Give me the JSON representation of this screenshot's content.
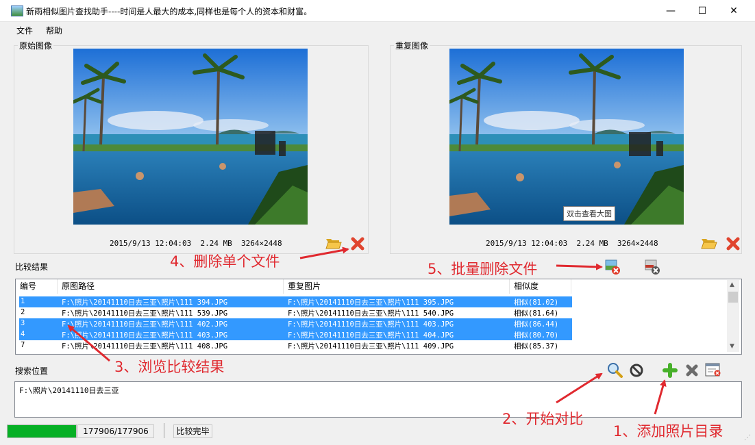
{
  "window": {
    "title": "新雨相似图片查找助手----时间是人最大的成本,同样也是每个人的资本和财富。",
    "minimize_glyph": "—",
    "maximize_glyph": "☐",
    "close_glyph": "✕"
  },
  "menu": {
    "file": "文件",
    "help": "帮助"
  },
  "original_panel": {
    "label": "原始图像",
    "info": "2015/9/13 12:04:03  2.24 MB  3264×2448"
  },
  "duplicate_panel": {
    "label": "重复图像",
    "info": "2015/9/13 12:04:03  2.24 MB  3264×2448",
    "tooltip": "双击查看大图"
  },
  "results": {
    "label": "比较结果",
    "columns": [
      "编号",
      "原图路径",
      "重复图片",
      "相似度"
    ],
    "rows": [
      {
        "id": "1",
        "src": "F:\\照片\\20141110日去三亚\\照片\\111 394.JPG",
        "dup": "F:\\照片\\20141110日去三亚\\照片\\111 395.JPG",
        "sim": "相似(81.02)",
        "selected": true
      },
      {
        "id": "2",
        "src": "F:\\照片\\20141110日去三亚\\照片\\111 539.JPG",
        "dup": "F:\\照片\\20141110日去三亚\\照片\\111 540.JPG",
        "sim": "相似(81.64)",
        "selected": false
      },
      {
        "id": "3",
        "src": "F:\\照片\\20141110日去三亚\\照片\\111 402.JPG",
        "dup": "F:\\照片\\20141110日去三亚\\照片\\111 403.JPG",
        "sim": "相似(86.44)",
        "selected": true
      },
      {
        "id": "4",
        "src": "F:\\照片\\20141110日去三亚\\照片\\111 403.JPG",
        "dup": "F:\\照片\\20141110日去三亚\\照片\\111 404.JPG",
        "sim": "相似(80.70)",
        "selected": true
      },
      {
        "id": "7",
        "src": "F:\\照片\\20141110日去三亚\\照片\\111 408.JPG",
        "dup": "F:\\照片\\20141110日去三亚\\照片\\111 409.JPG",
        "sim": "相似(85.37)",
        "selected": false
      }
    ]
  },
  "search": {
    "label": "搜索位置",
    "paths": [
      "F:\\照片\\20141110日去三亚"
    ]
  },
  "status": {
    "progress_fraction": 1.0,
    "count": "177906/177906",
    "state": "比较完毕"
  },
  "annotations": {
    "a1": "1、添加照片目录",
    "a2": "2、开始对比",
    "a3": "3、浏览比较结果",
    "a4": "4、删除单个文件",
    "a5": "5、批量删除文件"
  },
  "colors": {
    "selection": "#3399ff",
    "annotation": "#e0292f",
    "progress": "#06b025"
  },
  "icons": [
    "folder-open-icon",
    "delete-red-x-icon",
    "batch-delete-image-icon",
    "batch-delete-dark-icon",
    "zoom-search-icon",
    "stop-icon",
    "add-plus-icon",
    "remove-x-icon",
    "clear-list-icon"
  ]
}
